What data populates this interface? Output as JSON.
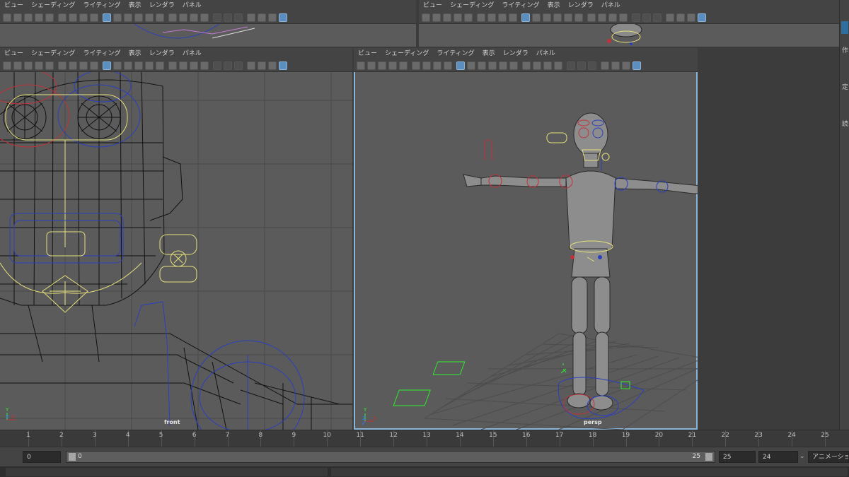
{
  "menu": [
    "ビュー",
    "シェーディング",
    "ライティング",
    "表示",
    "レンダラ",
    "パネル"
  ],
  "panels": {
    "top_left": {},
    "top_right": {},
    "front": {
      "camera": "front"
    },
    "persp": {
      "camera": "persp"
    }
  },
  "axis": {
    "x": "X",
    "y": "Y",
    "z": "Z"
  },
  "timeline": {
    "ticks": [
      "1",
      "2",
      "3",
      "4",
      "5",
      "6",
      "7",
      "8",
      "9",
      "10",
      "11",
      "12",
      "13",
      "14",
      "15",
      "16",
      "17",
      "18",
      "19",
      "20",
      "21",
      "22",
      "23",
      "24",
      "25"
    ]
  },
  "range": {
    "start": "0",
    "slider_start": "0",
    "slider_end": "25",
    "end": "25",
    "fps": "24",
    "anim_layer": "アニメーション レ"
  },
  "right_panel": {
    "labels": [
      "作",
      "定",
      "読"
    ]
  },
  "colors": {
    "viewport_bg": "#5b5b5b",
    "active_outline": "#8ab4d8",
    "wire": "#111111",
    "ctrl_yellow": "#e6e07a",
    "ctrl_red": "#c0323a",
    "ctrl_blue": "#2a3fbf",
    "ctrl_green": "#2cf02c"
  }
}
